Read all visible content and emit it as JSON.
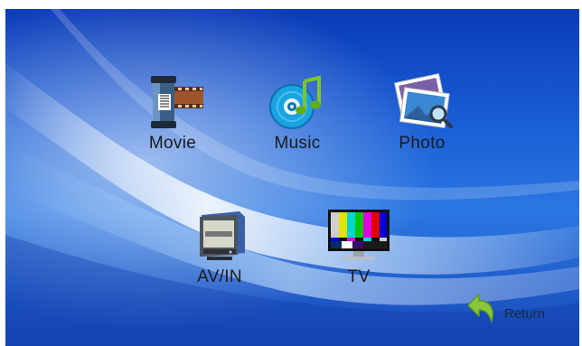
{
  "menu": {
    "items": [
      {
        "label": "Movie",
        "icon": "film-reel-icon"
      },
      {
        "label": "Music",
        "icon": "music-disc-icon"
      },
      {
        "label": "Photo",
        "icon": "photo-icon"
      },
      {
        "label": "AV/IN",
        "icon": "crt-monitor-icon"
      },
      {
        "label": "TV",
        "icon": "tv-test-pattern-icon"
      }
    ]
  },
  "return_button": {
    "label": "Return",
    "icon": "return-arrow-icon"
  },
  "colors": {
    "background_top": "#0b3bb8",
    "background_mid": "#2b77e2",
    "label_text": "#1b1b1b"
  }
}
